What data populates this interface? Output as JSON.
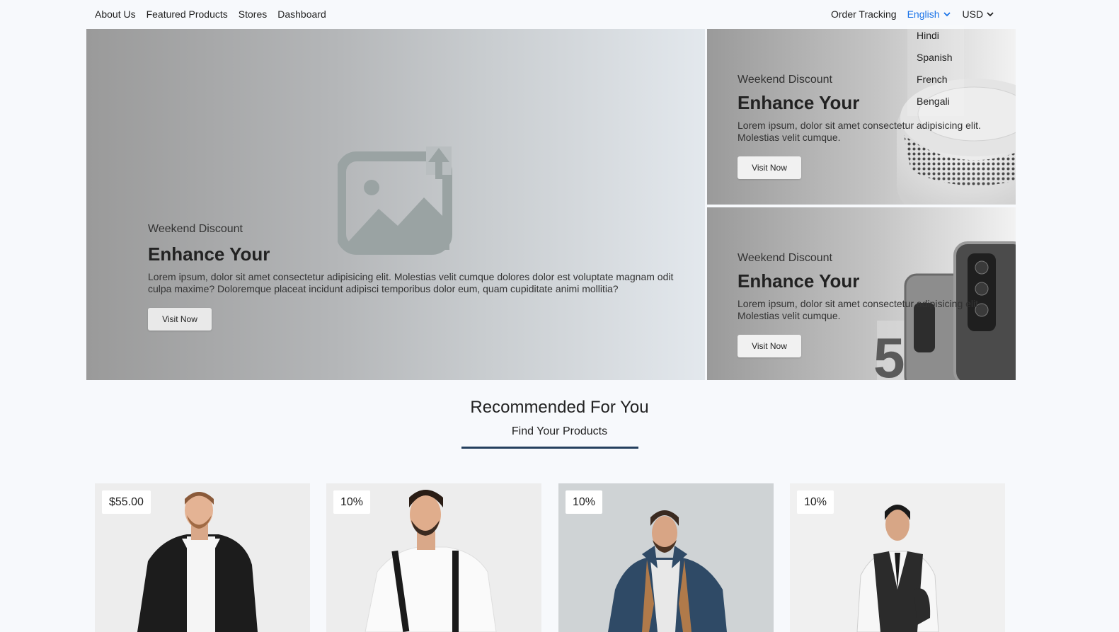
{
  "nav": {
    "left": [
      "About Us",
      "Featured Products",
      "Stores",
      "Dashboard"
    ],
    "order_tracking": "Order Tracking",
    "language": "English",
    "currency": "USD",
    "language_options": [
      "Hindi",
      "Spanish",
      "French",
      "Bengali"
    ]
  },
  "hero": {
    "main": {
      "eyebrow": "Weekend Discount",
      "title": "Enhance Your",
      "description": "Lorem ipsum, dolor sit amet consectetur adipisicing elit. Molestias velit cumque dolores dolor est voluptate magnam odit culpa maxime? Doloremque placeat incidunt adipisci temporibus dolor eum, quam cupiditate animi mollitia?",
      "button": "Visit Now"
    },
    "side_top": {
      "eyebrow": "Weekend Discount",
      "title": "Enhance Your",
      "description": "Lorem ipsum, dolor sit amet consectetur adipisicing elit. Molestias velit cumque.",
      "button": "Visit Now"
    },
    "side_bottom": {
      "eyebrow": "Weekend Discount",
      "title": "Enhance Your",
      "description": "Lorem ipsum, dolor sit amet consectetur adipisicing elit. Molestias velit cumque.",
      "button": "Visit Now"
    }
  },
  "recommended": {
    "title": "Recommended For You",
    "subtitle": "Find Your Products",
    "products": [
      {
        "badge": "$55.00"
      },
      {
        "badge": "10%"
      },
      {
        "badge": "10%"
      },
      {
        "badge": "10%"
      }
    ]
  },
  "colors": {
    "accent_link": "#1a73e8",
    "underline": "#25405e",
    "page_bg": "#f7f9fc"
  },
  "icons": [
    "chevron-down-icon",
    "image-upload-placeholder-icon"
  ]
}
